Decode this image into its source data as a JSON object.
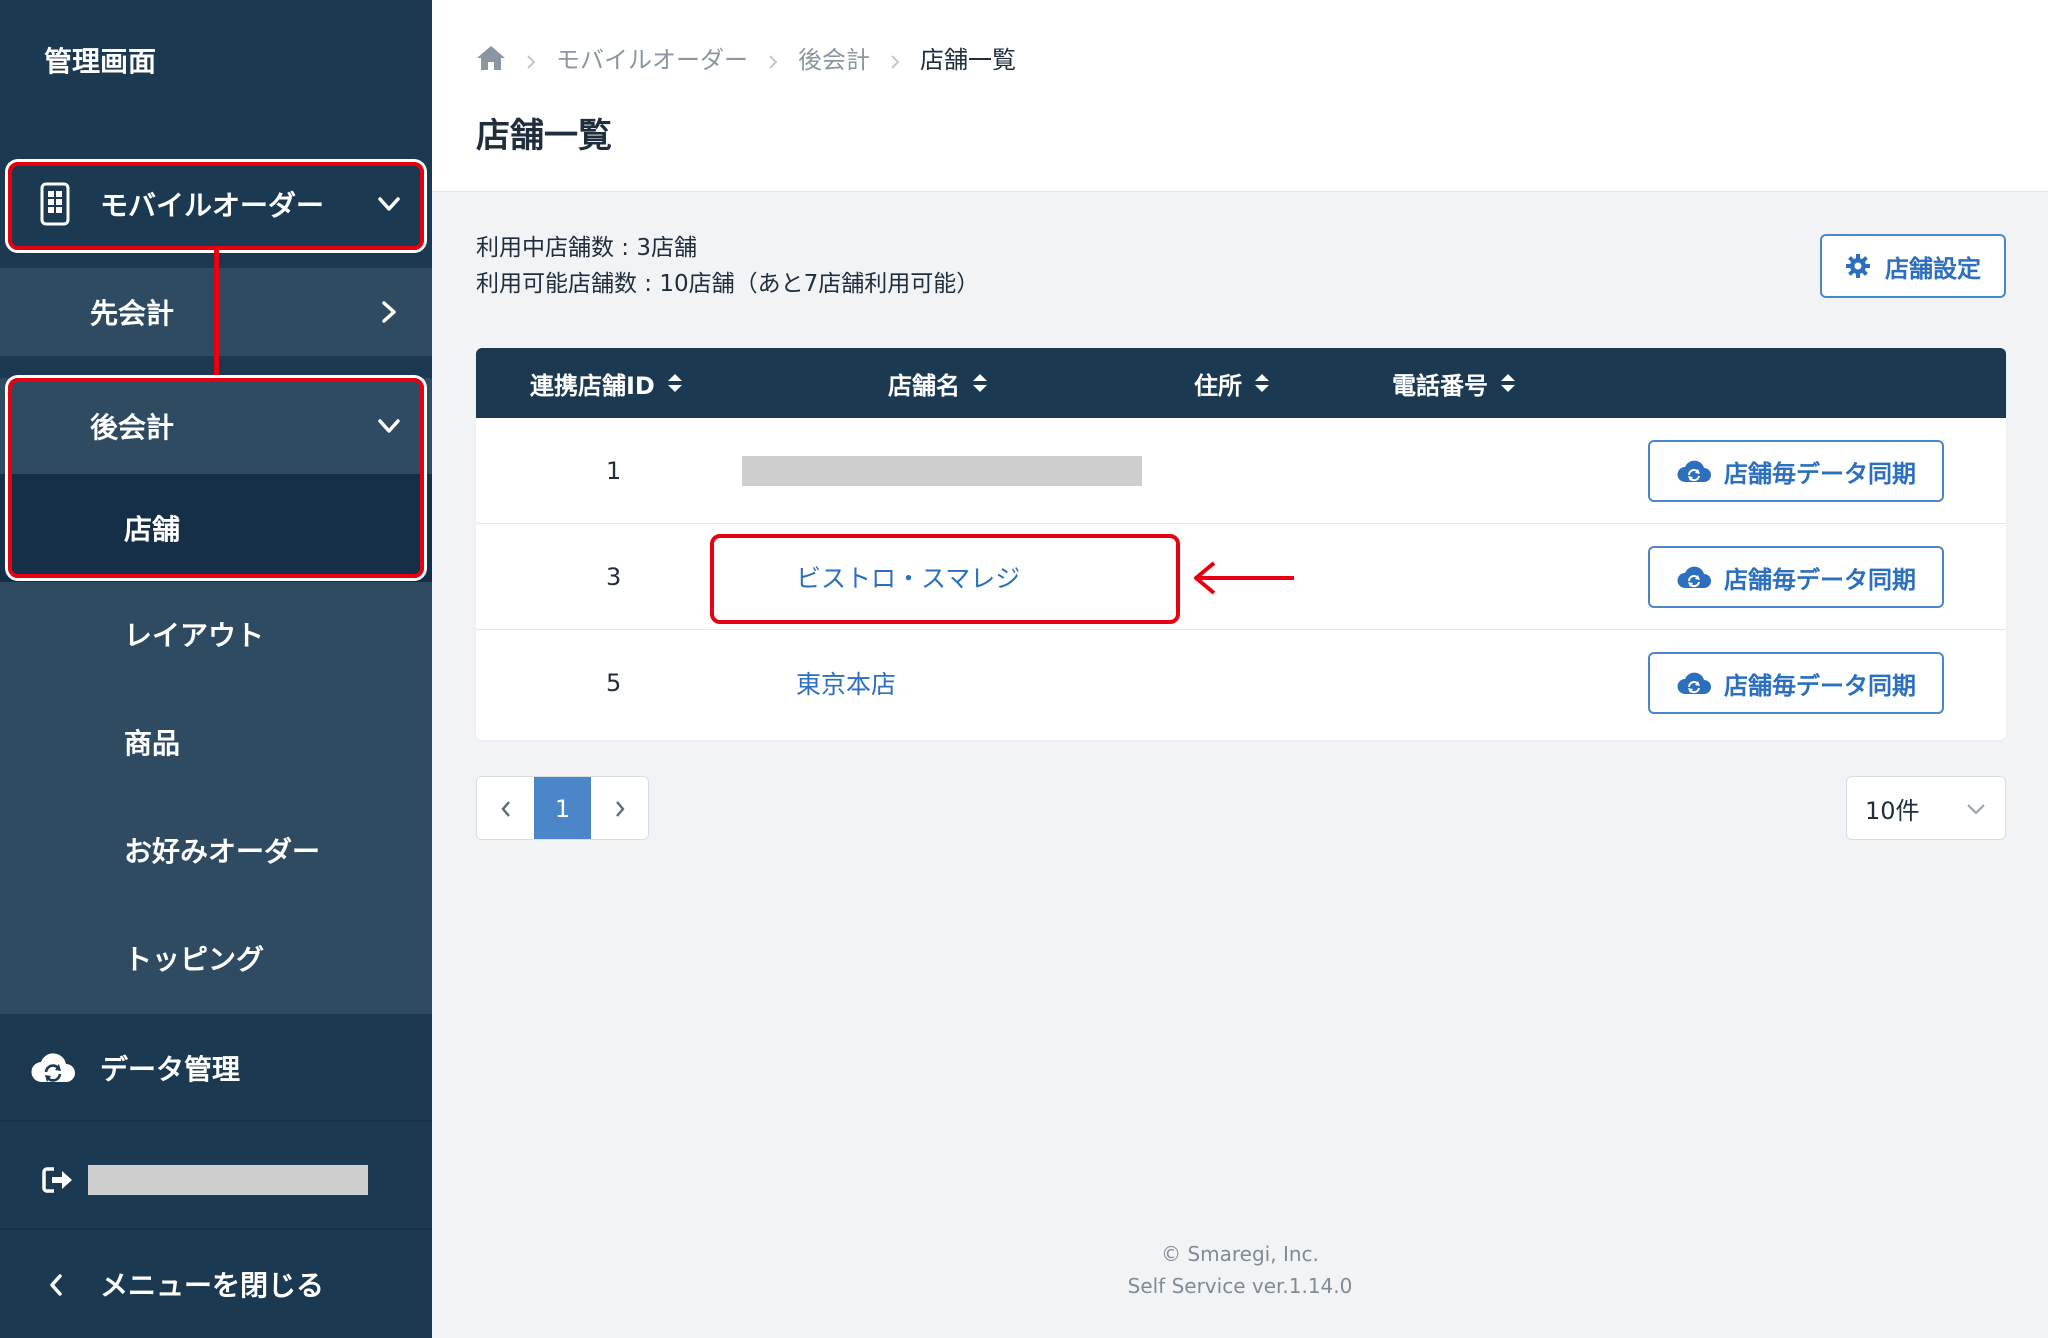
{
  "sidebar": {
    "title": "管理画面",
    "mobile_order": "モバイルオーダー",
    "pre_payment": "先会計",
    "post_payment": "後会計",
    "stores": "店舗",
    "sub_items": [
      "レイアウト",
      "商品",
      "お好みオーダー",
      "トッピング"
    ],
    "data_management": "データ管理",
    "close_menu": "メニューを閉じる"
  },
  "breadcrumb": {
    "items": [
      "モバイルオーダー",
      "後会計"
    ],
    "current": "店舗一覧"
  },
  "page": {
    "title": "店舗一覧",
    "in_use_count": "利用中店舗数 : 3店舗",
    "available_count": "利用可能店舗数 : 10店舗（あと7店舗利用可能）",
    "settings_button": "店舗設定"
  },
  "table": {
    "headers": [
      "連携店舗ID",
      "店舗名",
      "住所",
      "電話番号"
    ],
    "rows": [
      {
        "id": "1",
        "name": "",
        "sync_label": "店舗毎データ同期"
      },
      {
        "id": "3",
        "name": "ビストロ・スマレジ",
        "sync_label": "店舗毎データ同期"
      },
      {
        "id": "5",
        "name": "東京本店",
        "sync_label": "店舗毎データ同期"
      }
    ]
  },
  "pagination": {
    "current_page": "1",
    "per_page": "10件"
  },
  "footer": {
    "copyright": "© Smaregi, Inc.",
    "version": "Self Service ver.1.14.0"
  },
  "colors": {
    "sidebar_bg": "#1b3a52",
    "accent": "#4a86c8",
    "highlight": "#e60012"
  }
}
